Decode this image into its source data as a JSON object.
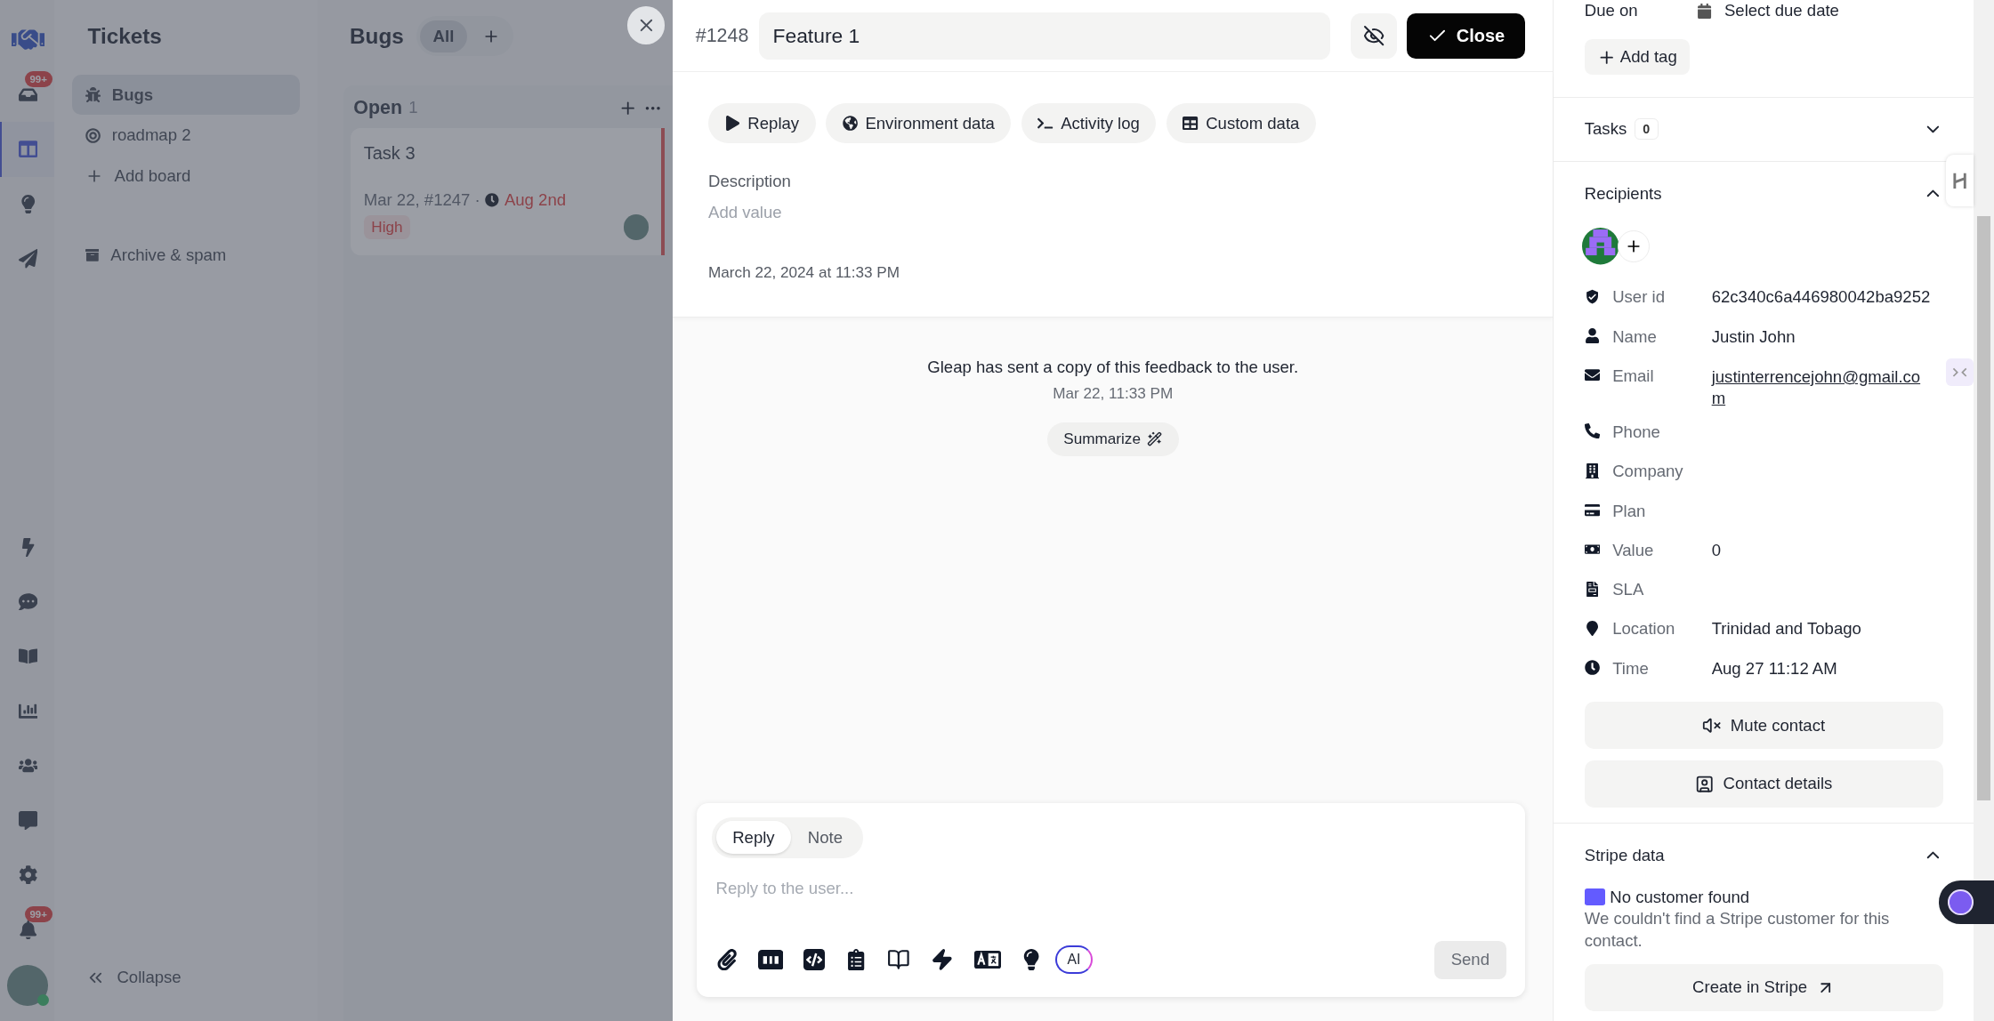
{
  "rail": {
    "items": [
      {
        "selected": false
      },
      {
        "selected": false,
        "badge": "99+"
      },
      {
        "selected": true
      },
      {
        "selected": false
      },
      {
        "selected": false
      },
      {
        "selected": false
      },
      {
        "selected": false
      },
      {
        "selected": false
      },
      {
        "selected": false
      },
      {
        "selected": false
      },
      {
        "selected": false
      },
      {
        "selected": false
      },
      {
        "selected": false,
        "badge": "99+"
      }
    ]
  },
  "sidebar": {
    "title": "Tickets",
    "boards": [
      {
        "label": "Bugs",
        "selected": true
      },
      {
        "label": "roadmap 2",
        "selected": false
      }
    ],
    "add_board": "Add board",
    "archive": "Archive & spam",
    "collapse": "Collapse"
  },
  "board": {
    "title": "Bugs",
    "filters": [
      {
        "label": "All",
        "selected": true
      }
    ],
    "columns": [
      {
        "name": "Open",
        "count": "1",
        "cards": [
          {
            "title": "Task 3",
            "meta": "Mar 22, #1247 ·",
            "due": "Aug 2nd",
            "priority": "High"
          }
        ]
      }
    ]
  },
  "ticket": {
    "number": "#1248",
    "title": "Feature 1",
    "close": "Close",
    "tabs": [
      "Replay",
      "Environment data",
      "Activity log",
      "Custom data"
    ],
    "description_label": "Description",
    "description_placeholder": "Add value",
    "created": "March 22, 2024 at 11:33 PM",
    "activity": {
      "message": "Gleap has sent a copy of this feedback to the user.",
      "time": "Mar 22, 11:33 PM",
      "summarize": "Summarize"
    },
    "composer": {
      "modes": [
        {
          "label": "Reply",
          "selected": true
        },
        {
          "label": "Note",
          "selected": false
        }
      ],
      "placeholder": "Reply to the user...",
      "ai": "AI",
      "send": "Send"
    }
  },
  "details": {
    "due_label": "Due on",
    "due_value": "Select due date",
    "add_tag": "Add tag",
    "tasks": {
      "label": "Tasks",
      "count": "0",
      "expanded": false
    },
    "recipients": {
      "label": "Recipients",
      "expanded": true,
      "fields": [
        {
          "label": "User id",
          "value": "62c340c6a446980042ba9252"
        },
        {
          "label": "Name",
          "value": "Justin John"
        },
        {
          "label": "Email",
          "value": "justinterrencejohn@gmail.com",
          "kind": "link"
        },
        {
          "label": "Phone"
        },
        {
          "label": "Company"
        },
        {
          "label": "Plan"
        },
        {
          "label": "Value",
          "value": "0"
        },
        {
          "label": "SLA"
        },
        {
          "label": "Location",
          "value": "Trinidad and Tobago"
        },
        {
          "label": "Time",
          "value": "Aug 27 11:12 AM"
        }
      ]
    },
    "mute": "Mute contact",
    "contact_details": "Contact details",
    "stripe": {
      "label": "Stripe data",
      "expanded": true,
      "status": "No customer found",
      "message": "We couldn't find a Stripe customer for this contact.",
      "create": "Create in Stripe"
    }
  }
}
